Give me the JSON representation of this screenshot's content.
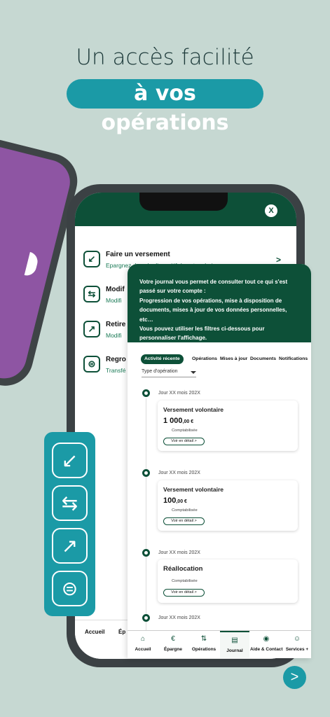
{
  "headline": {
    "line1": "Un accès facilité",
    "line2": "à vos opérations"
  },
  "close_label": "X",
  "menu": [
    {
      "icon": "arrow-down-left-icon",
      "glyph": "↙",
      "title": "Faire un versement",
      "subtitle": "Epargnez dans le dispositif de votre choix",
      "arrow": ">"
    },
    {
      "icon": "swap-icon",
      "glyph": "⇆",
      "title": "Modif",
      "subtitle": "Modifi"
    },
    {
      "icon": "arrow-up-right-icon",
      "glyph": "↗",
      "title": "Retire",
      "subtitle": "Modifi"
    },
    {
      "icon": "link-icon",
      "glyph": "⊜",
      "title": "Regro",
      "subtitle": "Transfé"
    }
  ],
  "main_nav": {
    "accueil": "Accueil",
    "epargne": "Ép"
  },
  "panel": {
    "intro_line1": "Votre journal vous permet de consulter tout ce qui s'est passé sur votre compte :",
    "intro_line2": "Progression de vos opérations, mise à disposition de documents, mises à jour de vos données personnelles, etc…",
    "intro_line3": "Vous pouvez utiliser les filtres ci-dessous pour personnaliser l'affichage.",
    "tabs": [
      "Activité récente",
      "Opérations",
      "Mises à jour",
      "Documents",
      "Notifications"
    ],
    "filter_label": "Type d'opération",
    "entries": [
      {
        "date": "Jour XX mois 202X",
        "title": "Versement volontaire",
        "amount": "1 000",
        "cents": ",00 €",
        "status": "Comptabilisée",
        "button": "Voir en détail >"
      },
      {
        "date": "Jour XX mois 202X",
        "title": "Versement volontaire",
        "amount": "100",
        "cents": ",00 €",
        "status": "Comptabilisée",
        "button": "Voir en détail >"
      },
      {
        "date": "Jour XX mois 202X",
        "title": "Réallocation",
        "status": "Comptabilisée",
        "button": "Voir en détail >"
      },
      {
        "date": "Jour XX mois 202X"
      }
    ],
    "nav": [
      "Accueil",
      "Épargne",
      "Opérations",
      "Journal",
      "Aide & Contact",
      "Services +"
    ]
  },
  "next_label": ">",
  "colors": {
    "teal": "#1b9aa6",
    "dark_green": "#0d5038",
    "background": "#c6d8d2"
  }
}
